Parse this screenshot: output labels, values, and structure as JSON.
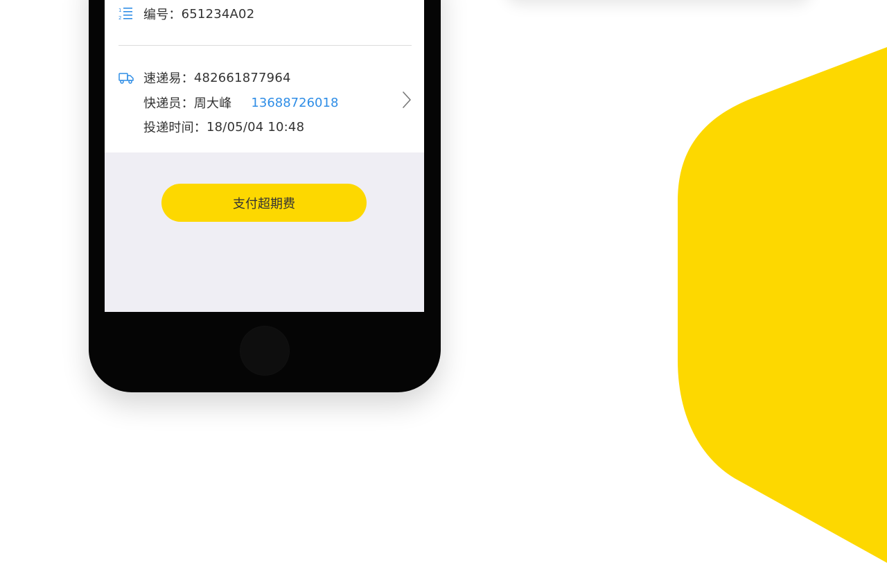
{
  "delivery": {
    "number_label": "编号：",
    "number_value": "651234A02",
    "courier_company_label": "速递易：",
    "courier_company_value": "482661877964",
    "courier_label": "快递员：",
    "courier_name": "周大峰",
    "courier_phone": "13688726018",
    "time_label": "投递时间：",
    "time_value": "18/05/04 10:48"
  },
  "actions": {
    "pay_overtime_label": "支付超期费"
  },
  "icons": {
    "number": "numbered-list-icon",
    "delivery": "truck-icon",
    "details": "chevron-right-icon"
  },
  "colors": {
    "accent_yellow": "#fdd800",
    "link_blue": "#2e8de6",
    "text": "#333333",
    "screen_bg": "#efeef4"
  }
}
